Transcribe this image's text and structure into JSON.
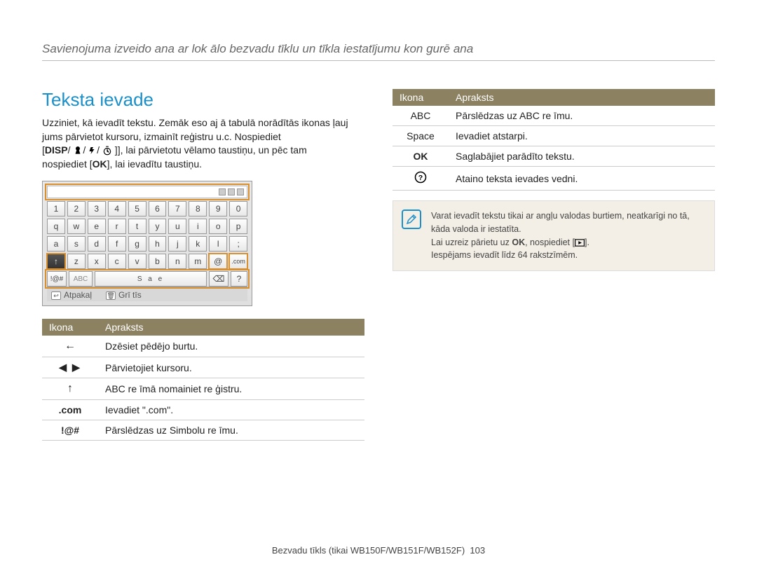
{
  "header": "Savienojuma izveido ana ar lok ālo bezvadu tīklu un tīkla iestatījumu kon  gurē ana",
  "section_title": "Teksta ievade",
  "para1": "Uzziniet, kā ievadīt tekstu. Zemāk eso aj ā tabulā norādītās ikonas ļauj jums pārvietot kursoru, izmainīt reģistru u.c. Nospiediet",
  "para2_before": "[",
  "para2_disp": "DISP",
  "para2_mid": "/",
  "para2_after": "], lai pārvietotu vēlamo taustiņu, un pēc tam",
  "para3_before": "nospiediet [",
  "para3_ok": "OK",
  "para3_after": "], lai ievadītu taustiņu.",
  "keyboard": {
    "rows": [
      [
        "1",
        "2",
        "3",
        "4",
        "5",
        "6",
        "7",
        "8",
        "9",
        "0"
      ],
      [
        "q",
        "w",
        "e",
        "r",
        "t",
        "y",
        "u",
        "i",
        "o",
        "p"
      ],
      [
        "a",
        "s",
        "d",
        "f",
        "g",
        "h",
        "j",
        "k",
        "l",
        ";"
      ],
      [
        "↑",
        "z",
        "x",
        "c",
        "v",
        "b",
        "n",
        "m",
        "@",
        ".com"
      ]
    ],
    "space_row": [
      "!@#",
      "ABC",
      "S  a  e",
      "⌫",
      "?"
    ],
    "footer_back": "Atpakaļ",
    "footer_del": "Grī tīs"
  },
  "table1": {
    "head": {
      "icon": "Ikona",
      "desc": "Apraksts"
    },
    "rows": [
      {
        "icon_type": "arrow-left",
        "icon_text": "←",
        "desc": "Dzēsiet pēdējo burtu."
      },
      {
        "icon_type": "arrows-lr",
        "icon_text": "◀  ▶",
        "desc": "Pārvietojiet kursoru."
      },
      {
        "icon_type": "arrow-up",
        "icon_text": "↑",
        "desc": "ABC re īmā nomainiet re ģistru."
      },
      {
        "icon_type": "text",
        "icon_text": ".com",
        "desc": "Ievadiet \".com\"."
      },
      {
        "icon_type": "text",
        "icon_text": "!@#",
        "desc": "Pārslēdzas uz Simbolu re  īmu."
      }
    ]
  },
  "table2": {
    "head": {
      "icon": "Ikona",
      "desc": "Apraksts"
    },
    "rows": [
      {
        "icon_text": "ABC",
        "desc": "Pārslēdzas uz ABC re  īmu."
      },
      {
        "icon_text": "Space",
        "desc": "Ievadiet atstarpi."
      },
      {
        "icon_text": "OK",
        "desc": "Saglabājiet parādīto tekstu."
      },
      {
        "icon_text": "?",
        "desc": "Ataino teksta ievades vedni."
      }
    ]
  },
  "note": {
    "line1": "Varat ievadīt tekstu tikai ar angļu valodas burtiem, neatkarīgi no tā, kāda valoda ir iestatīta.",
    "line2_before": "Lai uzreiz pārietu uz ",
    "line2_ok": "OK",
    "line2_mid": ", nospiediet [",
    "line2_after": "].",
    "line3": "Iespējams ievadīt līdz 64 rakstzīmēm."
  },
  "footer": {
    "text": "Bezvadu tīkls (tikai WB150F/WB151F/WB152F)",
    "page": "103"
  }
}
